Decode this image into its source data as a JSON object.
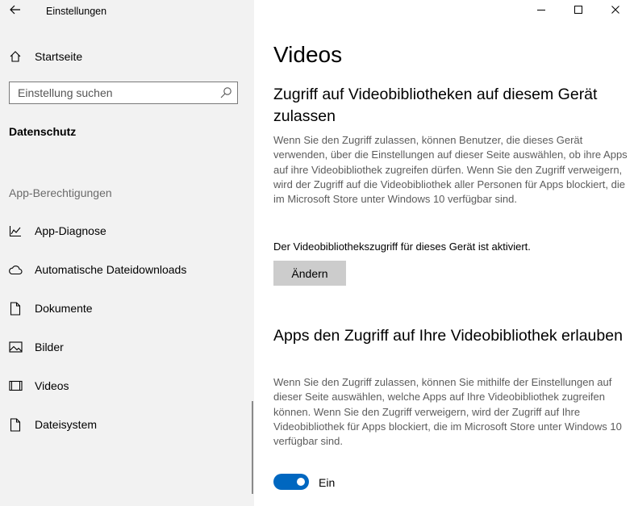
{
  "window": {
    "title": "Einstellungen",
    "controls": [
      "minimize-icon",
      "maximize-icon",
      "close-icon"
    ]
  },
  "sidebar": {
    "home_label": "Startseite",
    "search_placeholder": "Einstellung suchen",
    "section_title": "Datenschutz",
    "group_title": "App-Berechtigungen",
    "items": [
      {
        "label": "App-Diagnose",
        "icon": "chart-icon"
      },
      {
        "label": "Automatische Dateidownloads",
        "icon": "cloud-icon"
      },
      {
        "label": "Dokumente",
        "icon": "document-icon"
      },
      {
        "label": "Bilder",
        "icon": "image-icon"
      },
      {
        "label": "Videos",
        "icon": "video-icon"
      },
      {
        "label": "Dateisystem",
        "icon": "file-icon"
      }
    ]
  },
  "main": {
    "title": "Videos",
    "section1": {
      "heading": "Zugriff auf Videobibliotheken auf diesem Gerät zulassen",
      "description": "Wenn Sie den Zugriff zulassen, können Benutzer, die dieses Gerät verwenden, über die Einstellungen auf dieser Seite auswählen, ob ihre Apps auf ihre Videobibliothek zugreifen dürfen. Wenn Sie den Zugriff verweigern, wird der Zugriff auf die Videobibliothek aller Personen für Apps blockiert, die im Microsoft Store unter Windows 10 verfügbar sind.",
      "status": "Der Videobibliothekszugriff für dieses Gerät ist aktiviert.",
      "button_label": "Ändern"
    },
    "section2": {
      "heading": "Apps den Zugriff auf Ihre Videobibliothek erlauben",
      "description": "Wenn Sie den Zugriff zulassen, können Sie mithilfe der Einstellungen auf dieser Seite auswählen, welche Apps auf Ihre Videobibliothek zugreifen können. Wenn Sie den Zugriff verweigern, wird der Zugriff auf Ihre Videobibliothek für Apps blockiert, die im Microsoft Store unter Windows 10 verfügbar sind.",
      "toggle_state": "Ein",
      "toggle_on": true
    }
  },
  "colors": {
    "sidebar_bg": "#f2f2f2",
    "accent": "#0067c0",
    "button_bg": "#cccccc",
    "secondary_text": "#5c5c5c"
  }
}
